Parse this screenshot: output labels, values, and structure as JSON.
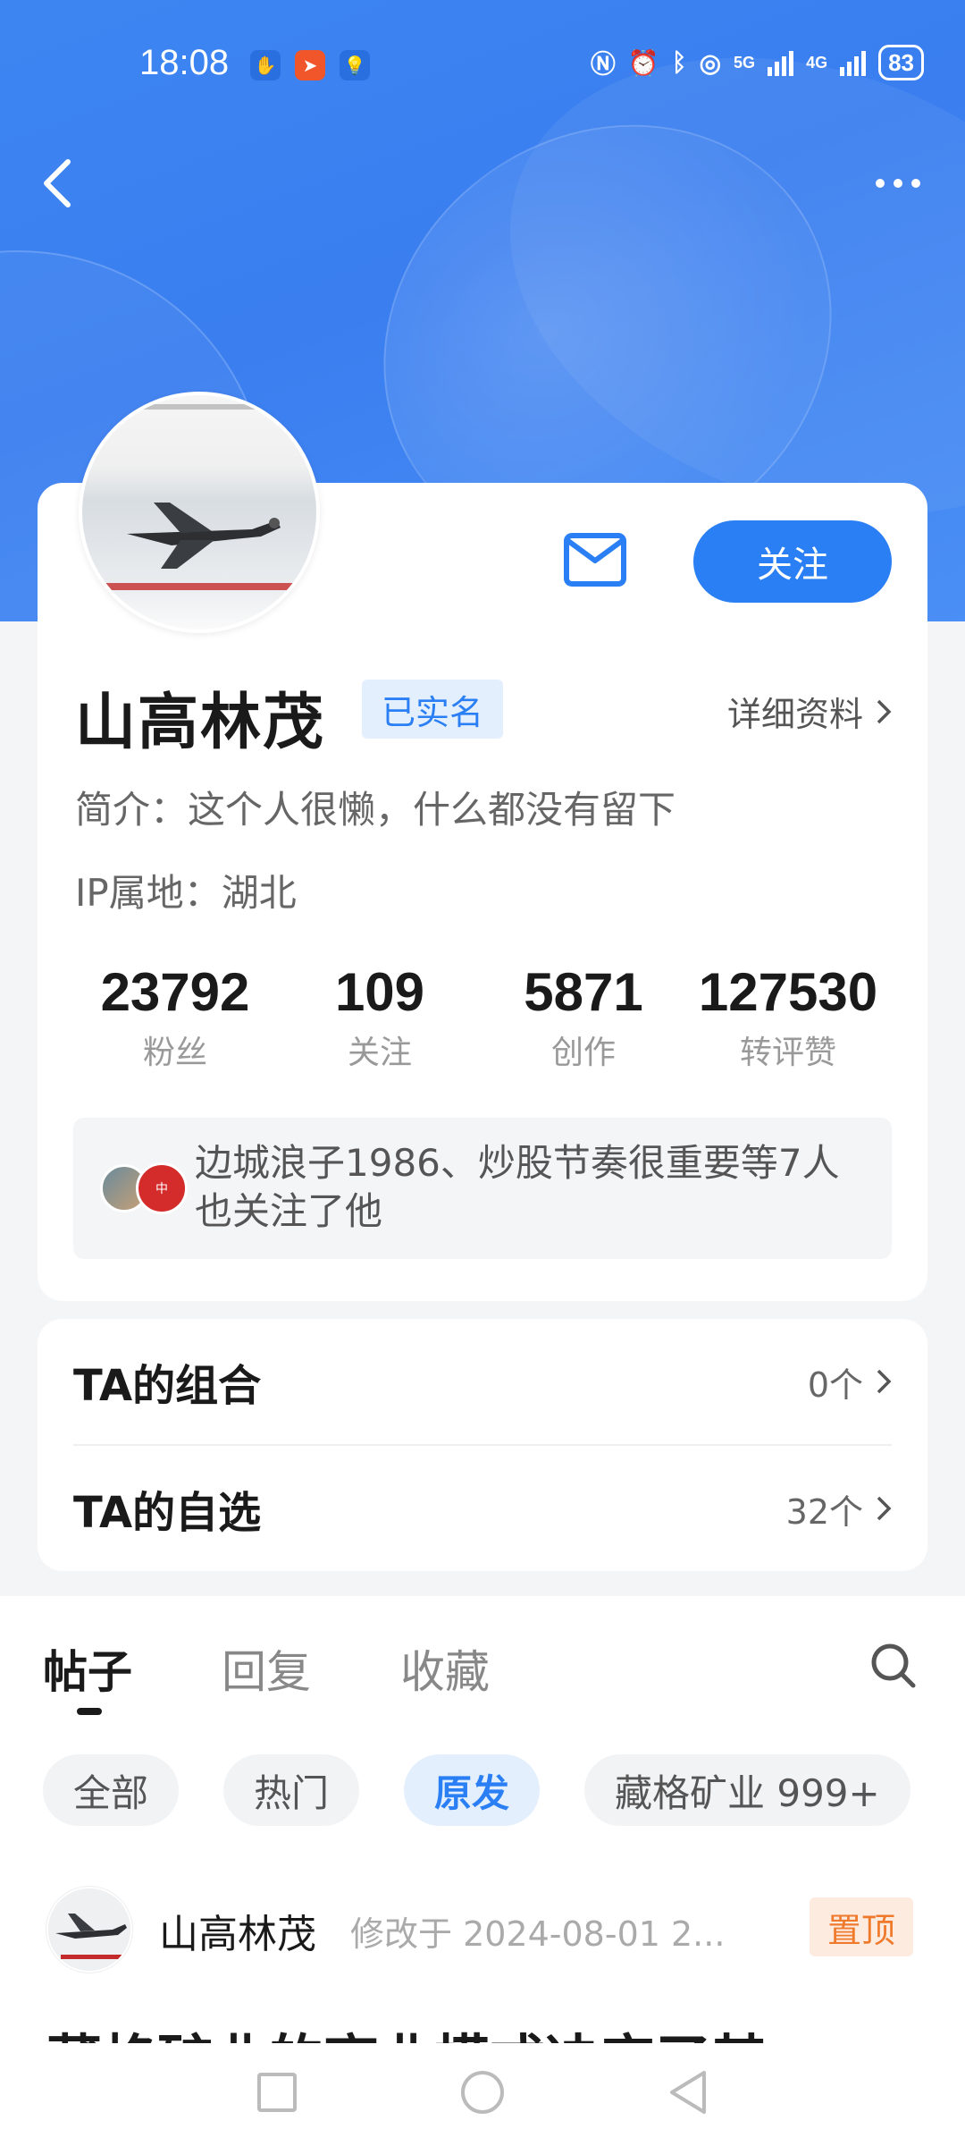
{
  "status_bar": {
    "time": "18:08",
    "battery": "83",
    "network_1": "5G",
    "network_2": "4G",
    "wifi_sup": "2"
  },
  "profile": {
    "name": "山高林茂",
    "verified": "已实名",
    "detail_link": "详细资料",
    "bio": "简介：这个人很懒，什么都没有留下",
    "ip": "IP属地：湖北",
    "follow_label": "关注",
    "stats": [
      {
        "value": "23792",
        "label": "粉丝"
      },
      {
        "value": "109",
        "label": "关注"
      },
      {
        "value": "5871",
        "label": "创作"
      },
      {
        "value": "127530",
        "label": "转评赞"
      }
    ],
    "mutual_text": "边城浪子1986、炒股节奏很重要等7人也关注了他"
  },
  "ta": {
    "rows": [
      {
        "label": "TA的组合",
        "value": "0个"
      },
      {
        "label": "TA的自选",
        "value": "32个"
      }
    ]
  },
  "tabs": [
    "帖子",
    "回复",
    "收藏"
  ],
  "chips": [
    "全部",
    "热门",
    "原发",
    "藏格矿业 999+"
  ],
  "post": {
    "author": "山高林茂",
    "meta": "修改于 2024-08-01 2...",
    "pin": "置顶",
    "title": "藏格矿业的商业模式决定了其"
  },
  "colors": {
    "accent": "#2b7ff5",
    "header": "#3a7ef0",
    "pin": "#f07a2c"
  }
}
